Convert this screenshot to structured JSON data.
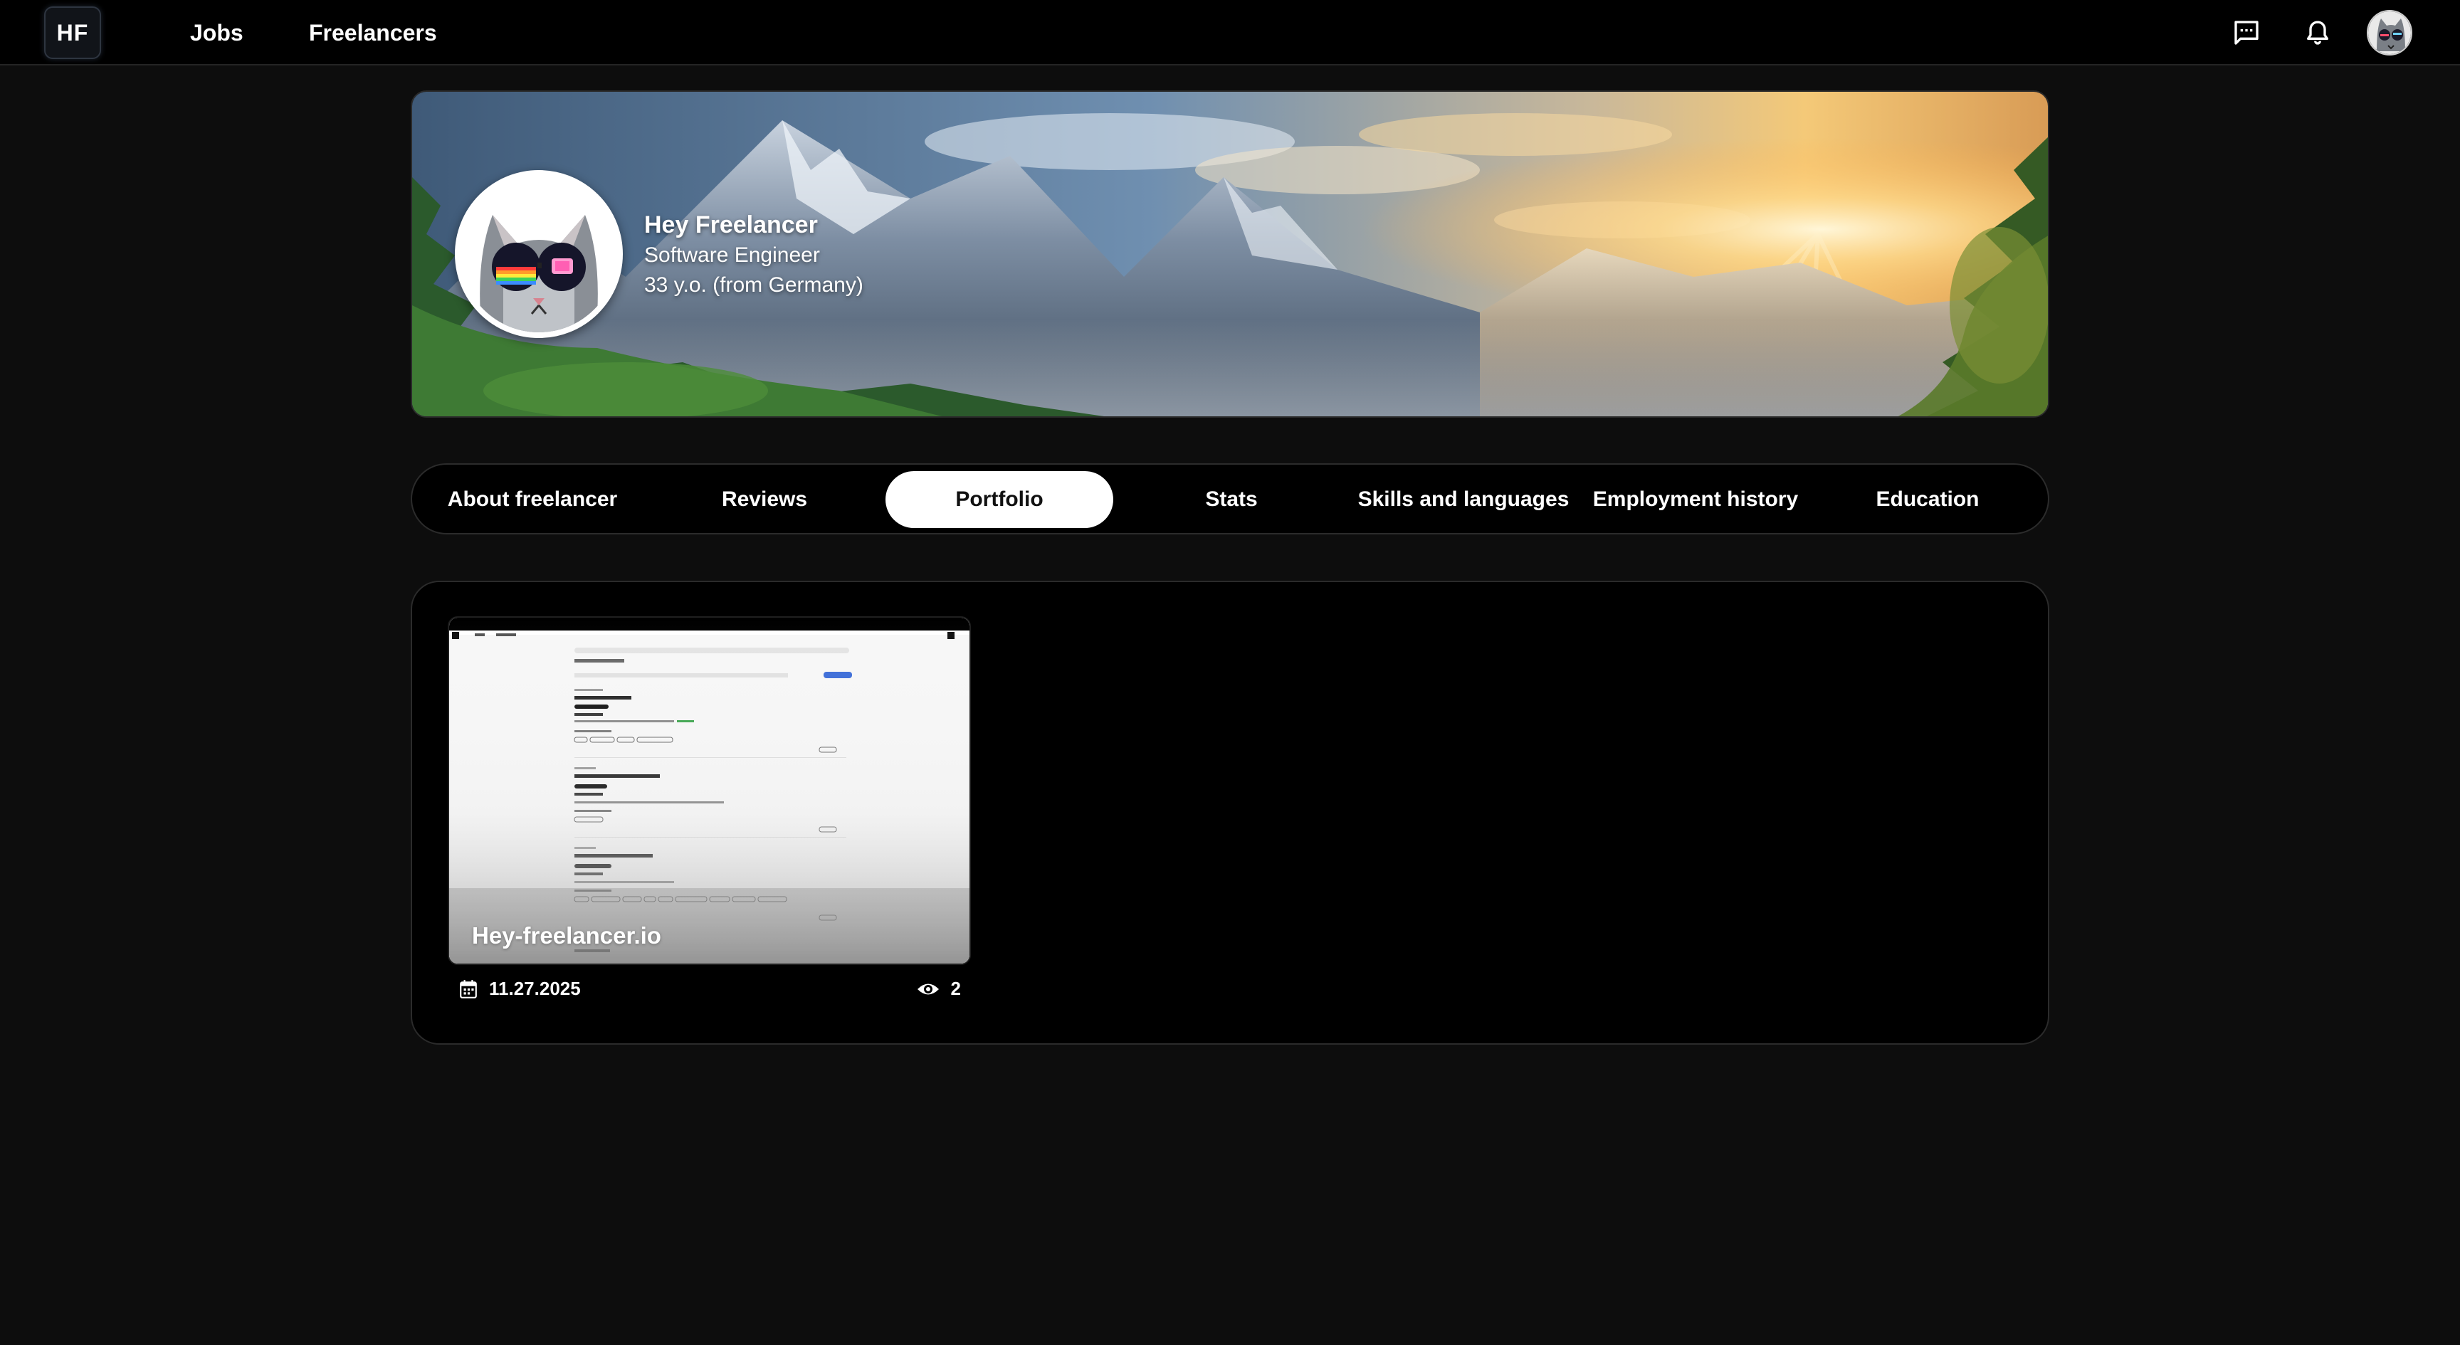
{
  "app": {
    "logo_text": "HF"
  },
  "nav": {
    "jobs_label": "Jobs",
    "freelancers_label": "Freelancers"
  },
  "topbar_icons": [
    "messages-icon",
    "bell-icon",
    "user-avatar"
  ],
  "profile": {
    "name": "Hey Freelancer",
    "title": "Software Engineer",
    "age_location": "33 y.o. (from Germany)"
  },
  "tabs": [
    {
      "label": "About freelancer",
      "active": false
    },
    {
      "label": "Reviews",
      "active": false
    },
    {
      "label": "Portfolio",
      "active": true
    },
    {
      "label": "Stats",
      "active": false
    },
    {
      "label": "Skills and languages",
      "active": false
    },
    {
      "label": "Employment history",
      "active": false
    },
    {
      "label": "Education",
      "active": false
    }
  ],
  "portfolio": {
    "items": [
      {
        "title": "Hey-freelancer.io",
        "date": "11.27.2025",
        "views": "2"
      }
    ]
  },
  "colors": {
    "background": "#0d0d0d",
    "surface": "#000000",
    "active_tab_bg": "#ffffff",
    "active_tab_text": "#111111",
    "text": "#ffffff"
  }
}
